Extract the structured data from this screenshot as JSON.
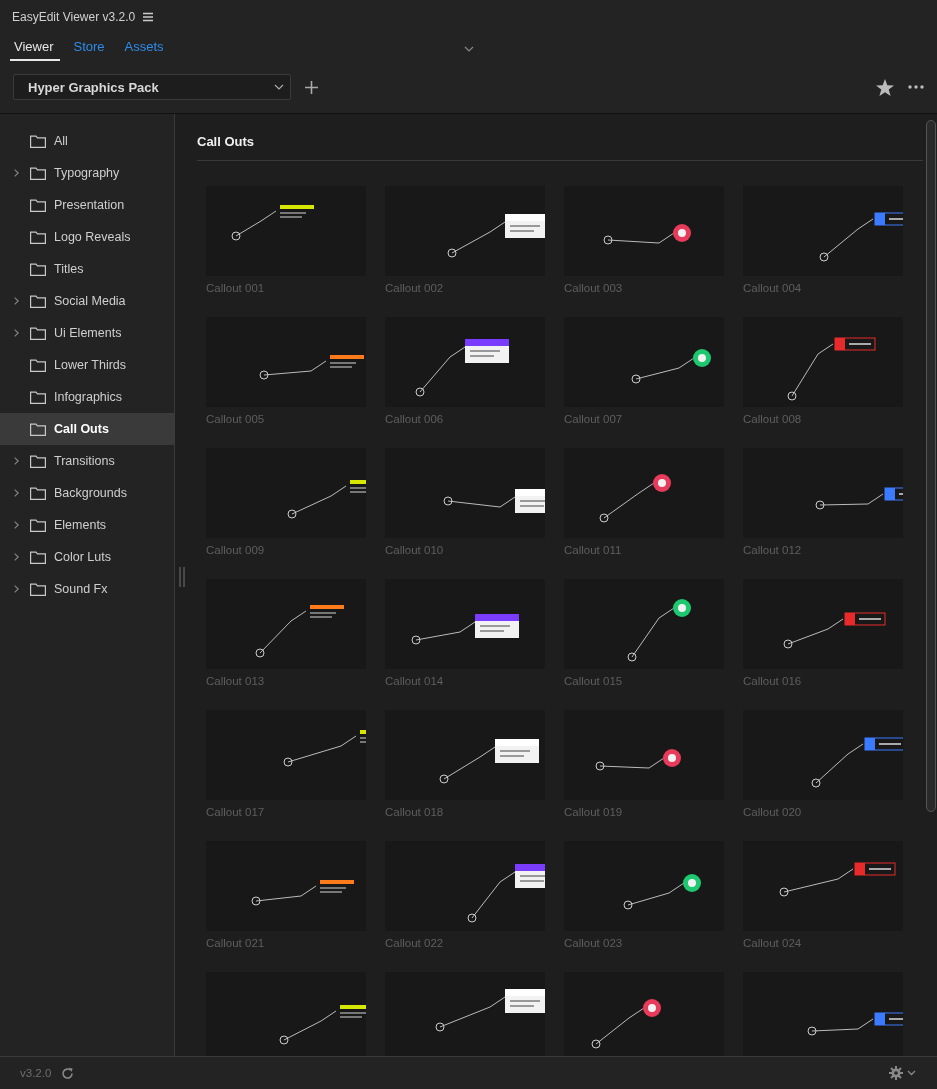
{
  "window": {
    "title": "EasyEdit Viewer v3.2.0"
  },
  "tabs": [
    {
      "label": "Viewer",
      "selected": true
    },
    {
      "label": "Store",
      "selected": false
    },
    {
      "label": "Assets",
      "selected": false
    }
  ],
  "toolbar": {
    "pack_dropdown": {
      "value": "Hyper Graphics Pack"
    }
  },
  "sidebar": {
    "items": [
      {
        "label": "All",
        "expandable": false,
        "selected": false
      },
      {
        "label": "Typography",
        "expandable": true,
        "selected": false
      },
      {
        "label": "Presentation",
        "expandable": false,
        "selected": false
      },
      {
        "label": "Logo Reveals",
        "expandable": false,
        "selected": false
      },
      {
        "label": "Titles",
        "expandable": false,
        "selected": false
      },
      {
        "label": "Social Media",
        "expandable": true,
        "selected": false
      },
      {
        "label": "Ui Elements",
        "expandable": true,
        "selected": false
      },
      {
        "label": "Lower Thirds",
        "expandable": false,
        "selected": false
      },
      {
        "label": "Infographics",
        "expandable": false,
        "selected": false
      },
      {
        "label": "Call Outs",
        "expandable": false,
        "selected": true
      },
      {
        "label": "Transitions",
        "expandable": true,
        "selected": false
      },
      {
        "label": "Backgrounds",
        "expandable": true,
        "selected": false
      },
      {
        "label": "Elements",
        "expandable": true,
        "selected": false
      },
      {
        "label": "Color Luts",
        "expandable": true,
        "selected": false
      },
      {
        "label": "Sound Fx",
        "expandable": true,
        "selected": false
      }
    ]
  },
  "gallery": {
    "heading": "Call Outs",
    "items": [
      {
        "kind": "picture",
        "caption": "Callout 001"
      },
      {
        "kind": "picture",
        "caption": "Callout 002"
      },
      {
        "kind": "picture",
        "caption": "Callout 003"
      },
      {
        "kind": "picture",
        "caption": "Callout 004"
      },
      {
        "kind": "picture",
        "caption": "Callout 005"
      },
      {
        "kind": "picture",
        "caption": "Callout 006"
      },
      {
        "kind": "picture",
        "caption": "Callout 007"
      },
      {
        "kind": "picture",
        "caption": "Callout 008"
      },
      {
        "kind": "picture",
        "caption": "Callout 009"
      },
      {
        "kind": "picture",
        "caption": "Callout 010"
      },
      {
        "kind": "picture",
        "caption": "Callout 011"
      },
      {
        "kind": "picture",
        "caption": "Callout 012"
      },
      {
        "kind": "picture",
        "caption": "Callout 013"
      },
      {
        "kind": "picture",
        "caption": "Callout 014"
      },
      {
        "kind": "picture",
        "caption": "Callout 015"
      },
      {
        "kind": "picture",
        "caption": "Callout 016"
      },
      {
        "kind": "picture",
        "caption": "Callout 017"
      },
      {
        "kind": "picture",
        "caption": "Callout 018"
      },
      {
        "kind": "picture",
        "caption": "Callout 019"
      },
      {
        "kind": "picture",
        "caption": "Callout 020"
      },
      {
        "kind": "picture",
        "caption": "Callout 021"
      },
      {
        "kind": "picture",
        "caption": "Callout 022"
      },
      {
        "kind": "picture",
        "caption": "Callout 023"
      },
      {
        "kind": "picture",
        "caption": "Callout 024"
      },
      {
        "kind": "picture"
      },
      {
        "kind": "picture"
      },
      {
        "kind": "picture"
      },
      {
        "kind": "picture"
      }
    ]
  },
  "status_bar": {
    "version": "v3.2.0"
  }
}
